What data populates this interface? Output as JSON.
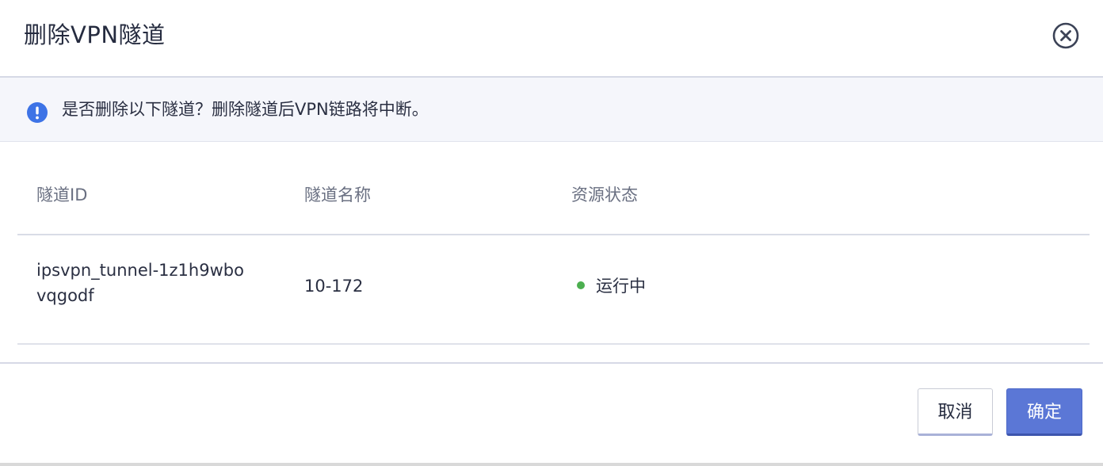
{
  "dialog": {
    "title": "删除VPN隧道",
    "close_icon": "close-circle-icon"
  },
  "notice": {
    "icon": "exclamation-circle-icon",
    "icon_color": "#3d73e6",
    "text": "是否删除以下隧道？删除隧道后VPN链路将中断。"
  },
  "table": {
    "headers": [
      "隧道ID",
      "隧道名称",
      "资源状态"
    ],
    "rows": [
      {
        "id_line1": "ipsvpn_tunnel-1z1h9wbo",
        "id_line2": "vqgodf",
        "name": "10-172",
        "status": "运行中",
        "status_color": "#4caf50"
      }
    ]
  },
  "footer": {
    "cancel_label": "取消",
    "confirm_label": "确定",
    "accent_color": "#5b77d6"
  }
}
